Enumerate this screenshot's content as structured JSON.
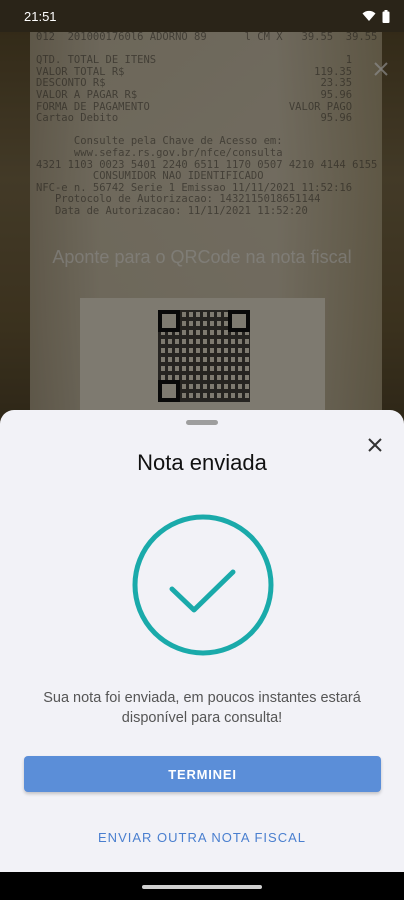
{
  "status_bar": {
    "time": "21:51",
    "wifi_icon": "wifi-icon",
    "battery_icon": "battery-icon"
  },
  "camera": {
    "hint": "Aponte para o QRCode na nota fiscal",
    "close_icon": "close-icon",
    "receipt_text": [
      "012  2010001760l6 ADORNO 89      l CM X   39.55  39.55",
      "",
      "QTD. TOTAL DE ITENS                              1",
      "VALOR TOTAL R$                              119.35",
      "DESCONTO R$                                  23.35",
      "VALOR A PAGAR R$                             95.96",
      "FORMA DE PAGAMENTO                      VALOR PAGO",
      "Cartao Debito                                95.96",
      "",
      "      Consulte pela Chave de Acesso em:",
      "      www.sefaz.rs.gov.br/nfce/consulta",
      "4321 1103 0023 5401 2240 6511 1170 0507 4210 4144 6155",
      "         CONSUMIDOR NAO IDENTIFICADO",
      "NFC-e n. 56742 Serie 1 Emissao 11/11/2021 11:52:16",
      "   Protocolo de Autorizacao: 1432115018651144",
      "   Data de Autorizacao: 11/11/2021 11:52:20"
    ]
  },
  "sheet": {
    "close_icon": "close-icon",
    "title": "Nota enviada",
    "success_icon": "check-circle-icon",
    "message": "Sua nota foi enviada, em poucos instantes estará disponível para consulta!",
    "primary_button": "TERMINEI",
    "secondary_link": "ENVIAR OUTRA NOTA FISCAL",
    "accent_color": "#1aaaaa",
    "button_color": "#5b8ed8",
    "link_color": "#4a7fcf"
  }
}
